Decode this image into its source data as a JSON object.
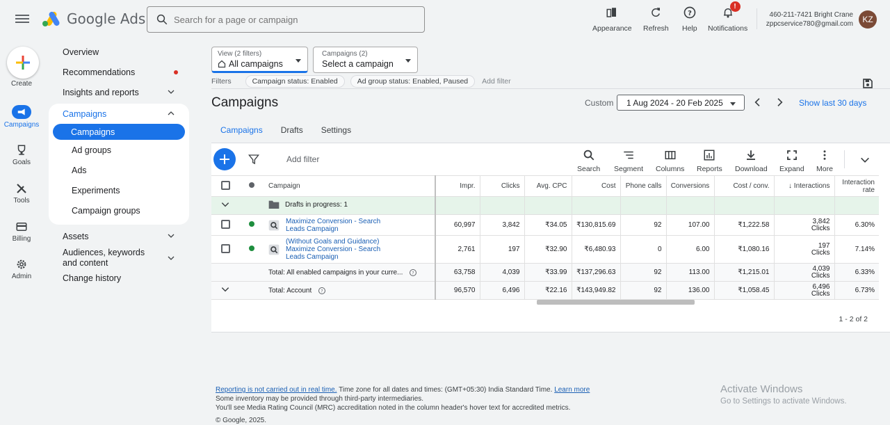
{
  "header": {
    "app_name": "Google Ads",
    "search_placeholder": "Search for a page or campaign",
    "actions": [
      {
        "label": "Appearance"
      },
      {
        "label": "Refresh"
      },
      {
        "label": "Help"
      },
      {
        "label": "Notifications",
        "badge": "!"
      }
    ],
    "account_line1": "460-211-7421 Bright Crane",
    "account_line2": "zppcservice780@gmail.com",
    "avatar_initials": "KZ"
  },
  "rail": {
    "create_label": "Create",
    "items": [
      {
        "label": "Campaigns",
        "active": true
      },
      {
        "label": "Goals"
      },
      {
        "label": "Tools"
      },
      {
        "label": "Billing"
      },
      {
        "label": "Admin"
      }
    ]
  },
  "nav": {
    "overview": "Overview",
    "recommendations": "Recommendations",
    "insights": "Insights and reports",
    "campaigns_group": "Campaigns",
    "sub_items": [
      "Campaigns",
      "Ad groups",
      "Ads",
      "Experiments",
      "Campaign groups"
    ],
    "assets": "Assets",
    "audiences": "Audiences, keywords and content",
    "change_history": "Change history"
  },
  "filters": {
    "view_small": "View (2 filters)",
    "view_value": "All campaigns",
    "campaigns_small": "Campaigns (2)",
    "campaigns_value": "Select a campaign",
    "label": "Filters",
    "chip1": "Campaign status: Enabled",
    "chip2": "Ad group status: Enabled, Paused",
    "add_filter": "Add filter"
  },
  "page": {
    "title": "Campaigns",
    "date_mode": "Custom",
    "date_range": "1 Aug 2024 - 20 Feb 2025",
    "show_last": "Show last 30 days",
    "tabs": [
      "Campaigns",
      "Drafts",
      "Settings"
    ]
  },
  "toolbar": {
    "add_filter": "Add filter",
    "buttons": [
      "Search",
      "Segment",
      "Columns",
      "Reports",
      "Download",
      "Expand",
      "More"
    ]
  },
  "table": {
    "headers": [
      "Campaign",
      "Impr.",
      "Clicks",
      "Avg. CPC",
      "Cost",
      "Phone calls",
      "Conversions",
      "Cost / conv.",
      "Interactions",
      "Interaction rate"
    ],
    "drafts": "Drafts in progress: 1",
    "rows": [
      {
        "name_line1": "Maximize Conversion - Search",
        "name_line2": "Leads Campaign",
        "name_line3": "",
        "impr": "60,997",
        "clicks": "3,842",
        "cpc": "₹34.05",
        "cost": "₹130,815.69",
        "calls": "92",
        "conv": "107.00",
        "cost_conv": "₹1,222.58",
        "inter": "3,842",
        "inter_unit": "Clicks",
        "rate": "6.30%"
      },
      {
        "name_line1": "(Without Goals and Guidance)",
        "name_line2": "Maximize Conversion - Search",
        "name_line3": "Leads Campaign",
        "impr": "2,761",
        "clicks": "197",
        "cpc": "₹32.90",
        "cost": "₹6,480.93",
        "calls": "0",
        "conv": "6.00",
        "cost_conv": "₹1,080.16",
        "inter": "197",
        "inter_unit": "Clicks",
        "rate": "7.14%"
      }
    ],
    "total_enabled": {
      "label": "Total: All enabled campaigns in your curre...",
      "impr": "63,758",
      "clicks": "4,039",
      "cpc": "₹33.99",
      "cost": "₹137,296.63",
      "calls": "92",
      "conv": "113.00",
      "cost_conv": "₹1,215.01",
      "inter": "4,039",
      "inter_unit": "Clicks",
      "rate": "6.33%"
    },
    "total_account": {
      "label": "Total: Account",
      "impr": "96,570",
      "clicks": "6,496",
      "cpc": "₹22.16",
      "cost": "₹143,949.82",
      "calls": "92",
      "conv": "136.00",
      "cost_conv": "₹1,058.45",
      "inter": "6,496",
      "inter_unit": "Clicks",
      "rate": "6.73%"
    },
    "pager": "1 - 2 of 2"
  },
  "footer": {
    "link1": "Reporting is not carried out in real time.",
    "text1": " Time zone for all dates and times: (GMT+05:30) India Standard Time. ",
    "link2": "Learn more",
    "line2": "Some inventory may be provided through third-party intermediaries.",
    "line3": "You'll see Media Rating Council (MRC) accreditation noted in the column header's hover text for accredited metrics.",
    "copyright": "© Google, 2025."
  },
  "watermark": {
    "title": "Activate Windows",
    "subtitle": "Go to Settings to activate Windows."
  },
  "colors": {
    "accent": "#1a73e8",
    "enabled_green": "#1e8e3e",
    "draft_row": "#e6f4ea"
  }
}
